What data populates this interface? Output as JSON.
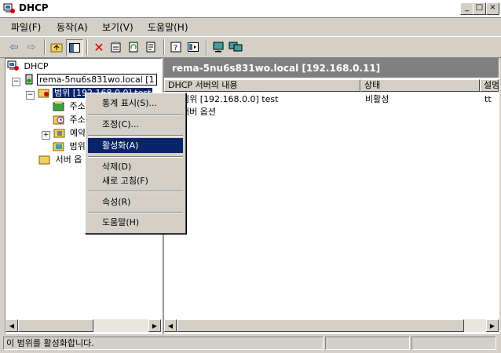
{
  "window": {
    "title": "DHCP"
  },
  "menu": {
    "items": [
      "파일(F)",
      "동작(A)",
      "보기(V)",
      "도움말(H)"
    ]
  },
  "toolbar": {
    "icons": [
      "back-arrow-icon",
      "forward-arrow-icon",
      "up-folder-icon",
      "show-hide-tree-icon",
      "delete-icon",
      "properties-icon",
      "refresh-icon",
      "export-list-icon",
      "help-icon",
      "console-icon",
      "monitor-icon",
      "monitor-add-icon"
    ]
  },
  "tree": {
    "root": "DHCP",
    "server": "rema-5nu6s831wo.local [1",
    "scope": "범위 [192.168.0.0] test",
    "child1": "주소",
    "child2": "주소",
    "child3": "예약",
    "child4": "범위",
    "server_options": "서버 옵"
  },
  "right": {
    "header": "rema-5nu6s831wo.local [192.168.0.11]",
    "columns": [
      "DHCP 서버의 내용",
      "상태",
      "설명"
    ],
    "rows": [
      {
        "content": "범위 [192.168.0.0] test",
        "status": "비활성",
        "desc": "tt"
      },
      {
        "content": "서버 옵션",
        "status": "",
        "desc": ""
      }
    ]
  },
  "context_menu": {
    "items": [
      "통계 표시(S)...",
      "조정(C)...",
      "활성화(A)",
      "삭제(D)",
      "새로 고침(F)",
      "속성(R)",
      "도움말(H)"
    ],
    "active": "활성화(A)"
  },
  "status": {
    "message": "이 범위를 활성화합니다."
  },
  "colors": {
    "selection": "#0a246a",
    "face": "#d4d0c8",
    "header_gray": "#808080"
  }
}
